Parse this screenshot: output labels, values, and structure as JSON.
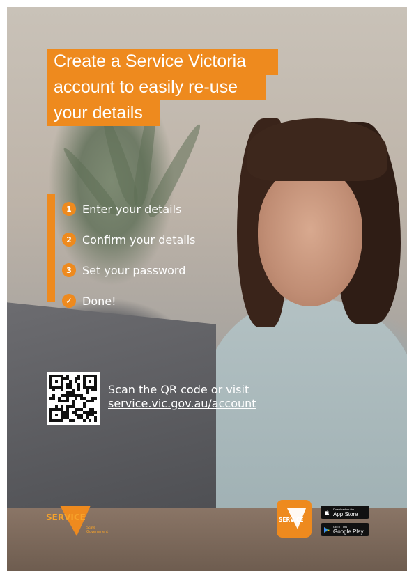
{
  "title": {
    "line1": "Create a Service Victoria",
    "line2": "account to easily re-use",
    "line3": "your details"
  },
  "steps": [
    {
      "num": "1",
      "label": "Enter your details"
    },
    {
      "num": "2",
      "label": "Confirm your details"
    },
    {
      "num": "3",
      "label": "Set your password"
    },
    {
      "num": "✓",
      "label": "Done!"
    }
  ],
  "qr_section": {
    "text": "Scan the QR code or visit",
    "link": "service.vic.gov.au/account"
  },
  "logo": {
    "wordmark": "SERVICE",
    "sub1": "State",
    "sub2": "Government"
  },
  "app_icon": {
    "wordmark": "SERVICE"
  },
  "badges": {
    "app_store_top": "Download on the",
    "app_store_main": "App Store",
    "google_top": "GET IT ON",
    "google_main": "Google Play"
  },
  "colors": {
    "accent": "#ee8a1e",
    "text": "#ffffff"
  }
}
